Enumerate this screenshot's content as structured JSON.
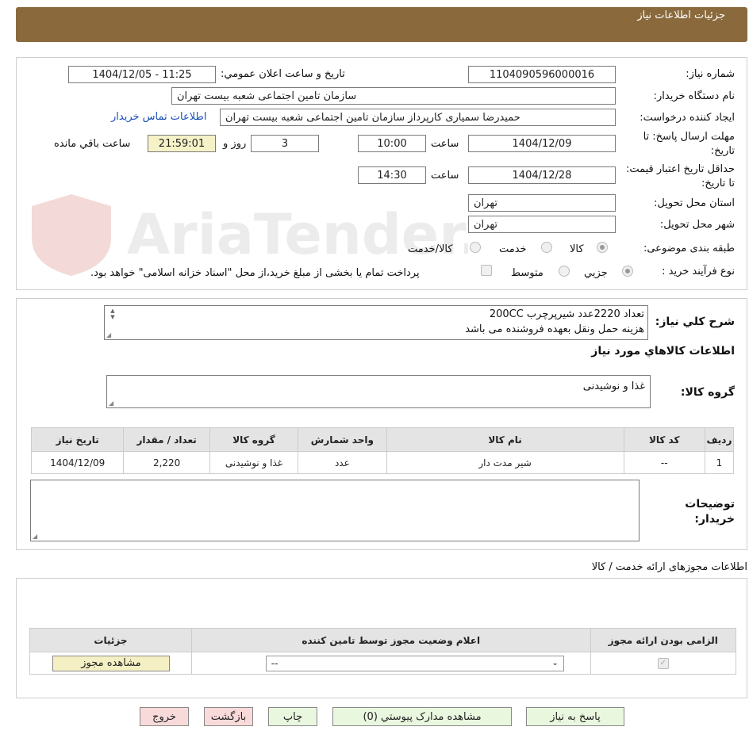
{
  "header": {
    "title": "جزئیات اطلاعات نیاز"
  },
  "form": {
    "need_number_label": "شماره نیاز:",
    "need_number": "1104090596000016",
    "announce_label": "تاریخ و ساعت اعلان عمومي:",
    "announce_value": "1404/12/05 - 11:25",
    "buyer_org_label": "نام دستگاه خریدار:",
    "buyer_org": "سازمان تامین اجتماعی شعبه بیست تهران",
    "requester_label": "ایجاد کننده درخواست:",
    "requester": "حمیدرضا سمیاری کارپرداز  سازمان تامین اجتماعی شعبه بیست تهران",
    "contact_link": "اطلاعات تماس خریدار",
    "deadline_label": "مهلت ارسال پاسخ: تا تاریخ:",
    "deadline_date": "1404/12/09",
    "time_label": "ساعت",
    "deadline_time": "10:00",
    "days_value": "3",
    "days_label": "روز و",
    "remaining_time": "21:59:01",
    "remaining_label": "ساعت باقي مانده",
    "validity_label": "حداقل تاریخ اعتبار قیمت: تا تاریخ:",
    "validity_date": "1404/12/28",
    "validity_time": "14:30",
    "province_label": "استان محل تحویل:",
    "province": "تهران",
    "city_label": "شهر محل تحویل:",
    "city": "تهران",
    "category_label": "طبقه بندی موضوعی:",
    "category_options": [
      "کالا",
      "خدمت",
      "کالا/خدمت"
    ],
    "process_label": "نوع فرآیند خرید :",
    "process_options": [
      "جزیي",
      "متوسط"
    ],
    "process_note": "پرداخت تمام یا بخشی از مبلغ خرید،از محل \"اسناد خزانه اسلامی\" خواهد بود."
  },
  "description": {
    "label": "شرح کلي نیاز:",
    "line1": "تعداد 2220عدد شیرپرچرب 200CC",
    "line2": "هزینه حمل ونقل بعهده فروشنده می باشد"
  },
  "goods": {
    "section_title": "اطلاعات کالاهاي مورد نیاز",
    "group_label": "گروه کالا:",
    "group_value": "غذا و نوشیدنی",
    "columns": [
      "ردیف",
      "کد کالا",
      "نام کالا",
      "واحد شمارش",
      "گروه کالا",
      "تعداد / مقدار",
      "تاریخ نیاز"
    ],
    "rows": [
      [
        "1",
        "--",
        "شیر مدت دار",
        "عدد",
        "غذا و نوشیدنی",
        "2,220",
        "1404/12/09"
      ]
    ],
    "buyer_notes_label": "توضیحات خریدار:"
  },
  "permits": {
    "section_title": "اطلاعات مجوزهای ارائه خدمت / کالا",
    "columns": [
      "الزامی بودن ارائه مجوز",
      "اعلام وضعیت مجوز توسط تامین کننده",
      "جزئیات"
    ],
    "select_value": "--",
    "view_button": "مشاهده مجوز"
  },
  "buttons": {
    "reply": "پاسخ به نیاز",
    "attachments": "مشاهده مدارک پیوستي (0)",
    "print": "چاپ",
    "back": "بازگشت",
    "exit": "خروج"
  },
  "colors": {
    "header": "#8a6a3c",
    "link": "#1a4fb8"
  }
}
